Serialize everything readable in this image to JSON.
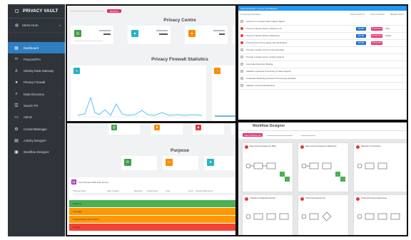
{
  "sidebar": {
    "brand": "PRIVACY VAULT",
    "user": "Verne Hum",
    "items": [
      {
        "label": "Dashboard",
        "icon": "grid-icon",
        "active": true
      },
      {
        "label": "Purpose/PIA",
        "icon": "infinity-icon"
      },
      {
        "label": "Identity Data Gateway",
        "icon": "gateway-icon"
      },
      {
        "label": "Privacy Firewall",
        "icon": "firewall-icon"
      },
      {
        "label": "Data Discovery",
        "icon": "search-icon",
        "expand": "‹"
      },
      {
        "label": "Search PII",
        "icon": "list-icon"
      },
      {
        "label": "Admin",
        "icon": "monitor-icon",
        "expand": "‹"
      },
      {
        "label": "ConsentManager",
        "icon": "gear-icon"
      },
      {
        "label": "Activity Designer",
        "icon": "editor-icon"
      },
      {
        "label": "Workflow Designer",
        "icon": "workflow-icon"
      }
    ]
  },
  "privacy_centre": {
    "button": "SEARCH",
    "title": "Privacy Centre",
    "firewall_title": "Privacy Firewall Statistics",
    "colors": [
      "#43a047",
      "#26b3c4",
      "#fb8c00",
      "#e53935"
    ]
  },
  "consent_panel": {
    "header": "Data Identification / Access and Mitigation",
    "columns": [
      "Processing Authorisation",
      "Data Assessment",
      "Issues and Risks",
      "Mitigation Status"
    ],
    "rows": [
      {
        "label": "Law Form on Voters Data Subject Rights"
      },
      {
        "label": "Prevent Transfer Data to Sweden Ltd",
        "actions": true,
        "status": "Open"
      },
      {
        "label": "Prevent Transfer Data to Marketing",
        "actions": true,
        "status": "Closed"
      },
      {
        "label": "Prevent Use of Incomplete Internal Dataset",
        "actions": true
      },
      {
        "label": "Provide a single record of personal data"
      },
      {
        "label": "Provide a single source of data subjects"
      },
      {
        "label": "Automated Decision Making"
      },
      {
        "label": "Validate Legitimate Processing of data subjects"
      },
      {
        "label": "Undertake Marketing Research Processing Activities"
      },
      {
        "label": "Validate Consent Mechanisms"
      }
    ],
    "button_a": "SHARE",
    "button_b": "MITIGATION"
  },
  "purpose_panel": {
    "title": "Purpose",
    "table_title": "Top Purposes With Risk Scores",
    "columns": [
      "Purpose Name",
      "Date Created",
      "Retention",
      "Preferences",
      "Type",
      "Level",
      "Purpose Risk Score"
    ],
    "rows": [
      {
        "name": "Marketing",
        "color": "#4caf50"
      },
      {
        "name": "Campaign",
        "color": "#ff9800"
      },
      {
        "name": "Transfer Data to Third Parties",
        "color": "#ff9800"
      },
      {
        "name": "Profiling",
        "color": "#f44336"
      }
    ]
  },
  "workflow": {
    "title": "Workflow Designer",
    "new_button": "NEW WORKFLOW",
    "cards": [
      {
        "title": "Data Consent Request for Mktg"
      },
      {
        "title": "Data Consent Request for Retirement"
      },
      {
        "title": "Objection to Processing"
      },
      {
        "title": "Collection Of Data Membership"
      },
      {
        "title": "Third Party Request Job"
      },
      {
        "title": "Preferred Process Data Access"
      }
    ]
  }
}
